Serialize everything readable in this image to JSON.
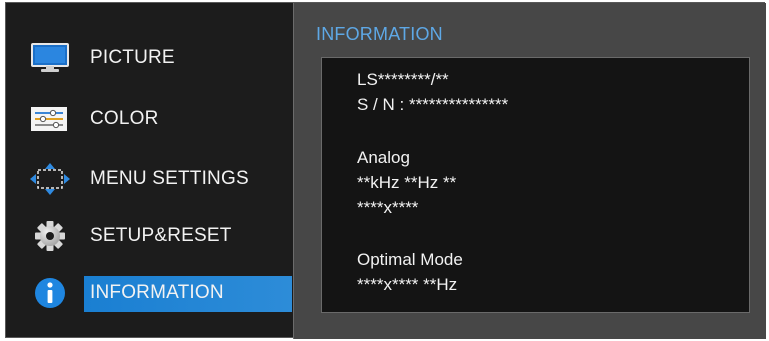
{
  "menu": {
    "items": [
      {
        "label": "PICTURE",
        "icon": "monitor-icon"
      },
      {
        "label": "COLOR",
        "icon": "color-sliders-icon"
      },
      {
        "label": "MENU SETTINGS",
        "icon": "move-arrows-icon"
      },
      {
        "label": "SETUP&RESET",
        "icon": "gear-icon"
      },
      {
        "label": "INFORMATION",
        "icon": "info-icon",
        "selected": true
      }
    ]
  },
  "info_panel": {
    "title": "INFORMATION",
    "lines": [
      "LS********/**",
      "S / N : ***************",
      "Analog",
      "**kHz **Hz **",
      "****x****",
      "Optimal Mode",
      "****x**** **Hz"
    ]
  },
  "colors": {
    "accent": "#1a7fd2",
    "title": "#5ea8e6",
    "background": "#1c1c1c",
    "panel": "#474747"
  }
}
